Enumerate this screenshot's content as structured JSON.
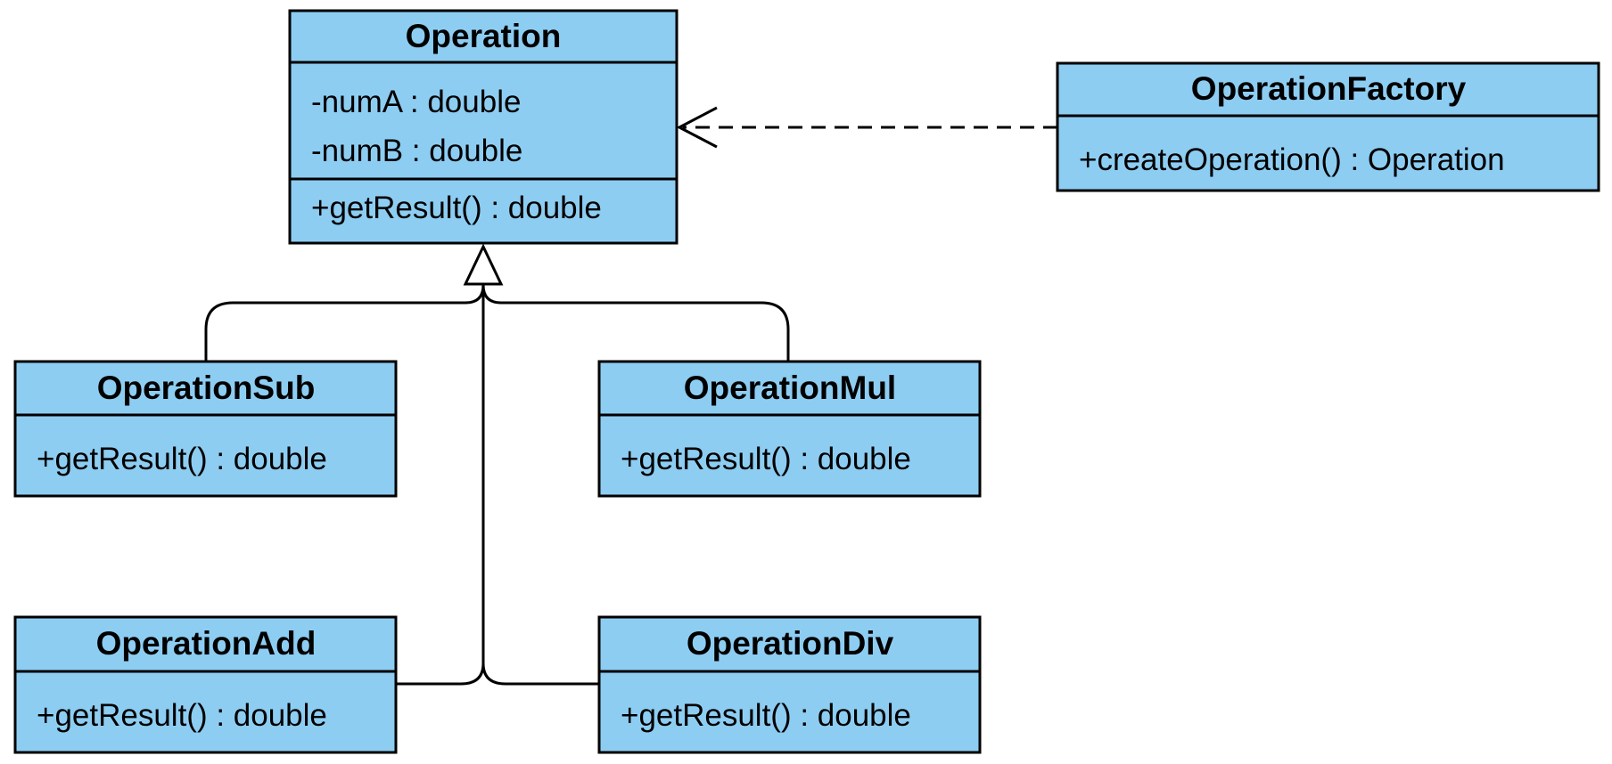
{
  "diagram": {
    "type": "UML class diagram",
    "fill_color": "#8ecdf2",
    "classes": [
      {
        "name": "Operation",
        "attributes": [
          "-numA : double",
          "-numB : double"
        ],
        "methods": [
          "+getResult() : double"
        ]
      },
      {
        "name": "OperationFactory",
        "attributes": [],
        "methods": [
          "+createOperation() : Operation"
        ]
      },
      {
        "name": "OperationSub",
        "attributes": [],
        "methods": [
          "+getResult() : double"
        ]
      },
      {
        "name": "OperationMul",
        "attributes": [],
        "methods": [
          "+getResult() : double"
        ]
      },
      {
        "name": "OperationAdd",
        "attributes": [],
        "methods": [
          "+getResult() : double"
        ]
      },
      {
        "name": "OperationDiv",
        "attributes": [],
        "methods": [
          "+getResult() : double"
        ]
      }
    ],
    "relations": [
      {
        "type": "dependency",
        "from": "OperationFactory",
        "to": "Operation"
      },
      {
        "type": "generalization",
        "from": "OperationSub",
        "to": "Operation"
      },
      {
        "type": "generalization",
        "from": "OperationMul",
        "to": "Operation"
      },
      {
        "type": "generalization",
        "from": "OperationAdd",
        "to": "Operation"
      },
      {
        "type": "generalization",
        "from": "OperationDiv",
        "to": "Operation"
      }
    ]
  }
}
